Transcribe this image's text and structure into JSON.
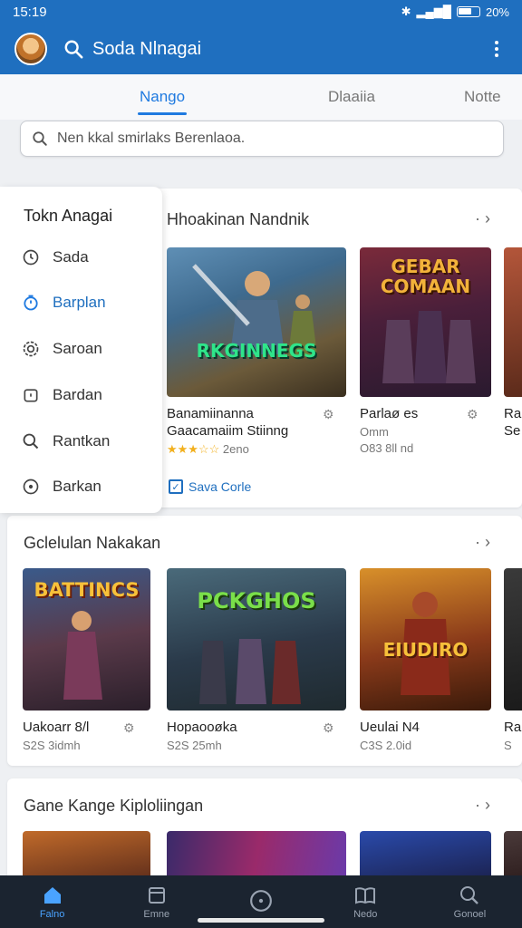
{
  "status": {
    "time": "15:19",
    "battery": "20%"
  },
  "app": {
    "title": "Soda Nlnagai"
  },
  "tabs": [
    {
      "label": "Nango",
      "active": true
    },
    {
      "label": "Dlaaiia",
      "active": false
    },
    {
      "label": "Notte",
      "active": false
    }
  ],
  "search": {
    "value": "Nen kkal smirlaks Berenlaoa."
  },
  "drawer": {
    "title": "Tokn Anagai",
    "items": [
      {
        "label": "Sada",
        "icon": "clock-icon"
      },
      {
        "label": "Barplan",
        "icon": "timer-icon",
        "active": true
      },
      {
        "label": "Saroan",
        "icon": "settings-icon"
      },
      {
        "label": "Bardan",
        "icon": "alarm-icon"
      },
      {
        "label": "Rantkan",
        "icon": "search-icon"
      },
      {
        "label": "Barkan",
        "icon": "compass-icon"
      }
    ]
  },
  "section1": {
    "title": "Hhoakinan Nandnik",
    "more": "· ›",
    "cards": [
      {
        "thumb_text": "RKGINNEGS",
        "title": "Banamiinanna\nGaacamaiim Stiinng",
        "meta": "2eno",
        "stars": "★★★☆☆"
      },
      {
        "thumb_text": "GEBAR COMAAN",
        "title": "Parlaø es",
        "meta": "Omm",
        "meta2": "O83  8ll nd"
      },
      {
        "thumb_text": "",
        "title": "Ra",
        "meta": "Se"
      }
    ],
    "save_label": "Sava Corle"
  },
  "section2": {
    "title": "Gclelulan Nakakan",
    "more": "· ›",
    "cards": [
      {
        "thumb_text": "BATTINCS",
        "title": "Uakoarr 8/l",
        "meta": "S2S  3idmh"
      },
      {
        "thumb_text": "PCKGHOS",
        "title": "Hopaooøka",
        "meta": "S2S  25mh"
      },
      {
        "thumb_text": "EIUDIRO",
        "title": "Ueulai N4",
        "meta": "C3S  2.0id"
      },
      {
        "thumb_text": "",
        "title": "Ra",
        "meta": "S"
      }
    ]
  },
  "section3": {
    "title": "Gane Kange Kiploliingan",
    "more": "· ›"
  },
  "bottomnav": [
    {
      "label": "Falno",
      "icon": "home-icon",
      "active": true
    },
    {
      "label": "Emne",
      "icon": "library-icon"
    },
    {
      "label": "",
      "icon": "compass-icon"
    },
    {
      "label": "Nedo",
      "icon": "book-icon"
    },
    {
      "label": "Gonoel",
      "icon": "search-icon"
    }
  ]
}
